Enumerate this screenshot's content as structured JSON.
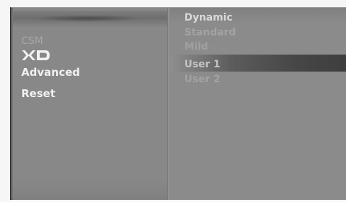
{
  "left_menu": {
    "csm_label": "CSM",
    "logo_icon": "xd-logo-icon",
    "advanced_label": "Advanced",
    "reset_label": "Reset"
  },
  "right_menu": {
    "items": [
      "Dynamic",
      "Standard",
      "Mild",
      "User 1",
      "User 2"
    ],
    "selected_index": 3
  },
  "colors": {
    "panel_bg": "#888888",
    "highlight": "#474747",
    "text_active": "#f0f0f0",
    "text_dim": "#a7a7a7"
  }
}
